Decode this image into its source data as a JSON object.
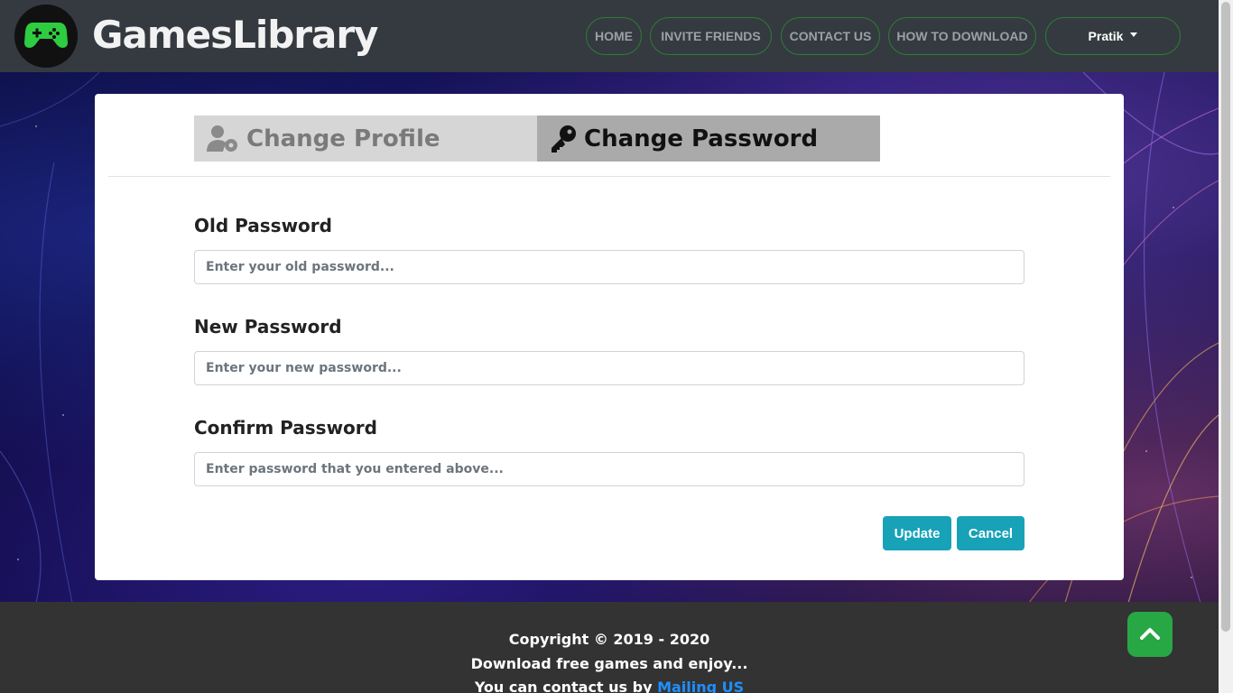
{
  "navbar": {
    "brand": "GamesLibrary",
    "links": [
      "HOME",
      "INVITE FRIENDS",
      "CONTACT US",
      "HOW TO DOWNLOAD"
    ],
    "user": "Pratik",
    "border_color": "#2e7d32"
  },
  "tabs": {
    "profile": "Change Profile",
    "password": "Change Password"
  },
  "form": {
    "old_label": "Old Password",
    "old_placeholder": "Enter your old password...",
    "new_label": "New Password",
    "new_placeholder": "Enter your new password...",
    "confirm_label": "Confirm Password",
    "confirm_placeholder": "Enter password that you entered above...",
    "update": "Update",
    "cancel": "Cancel"
  },
  "footer": {
    "copyright": "Copyright © 2019 - 2020",
    "tagline": "Download free games and enjoy...",
    "contact_prefix": "You can contact us by ",
    "contact_link": "Mailing US"
  },
  "colors": {
    "accent": "#17a2b8",
    "to_top": "#28a745",
    "navbar": "#343a40"
  },
  "icons": {
    "logo": "gamepad-icon",
    "profile_tab": "user-cog-icon",
    "password_tab": "key-icon",
    "to_top": "chevron-up-icon"
  }
}
